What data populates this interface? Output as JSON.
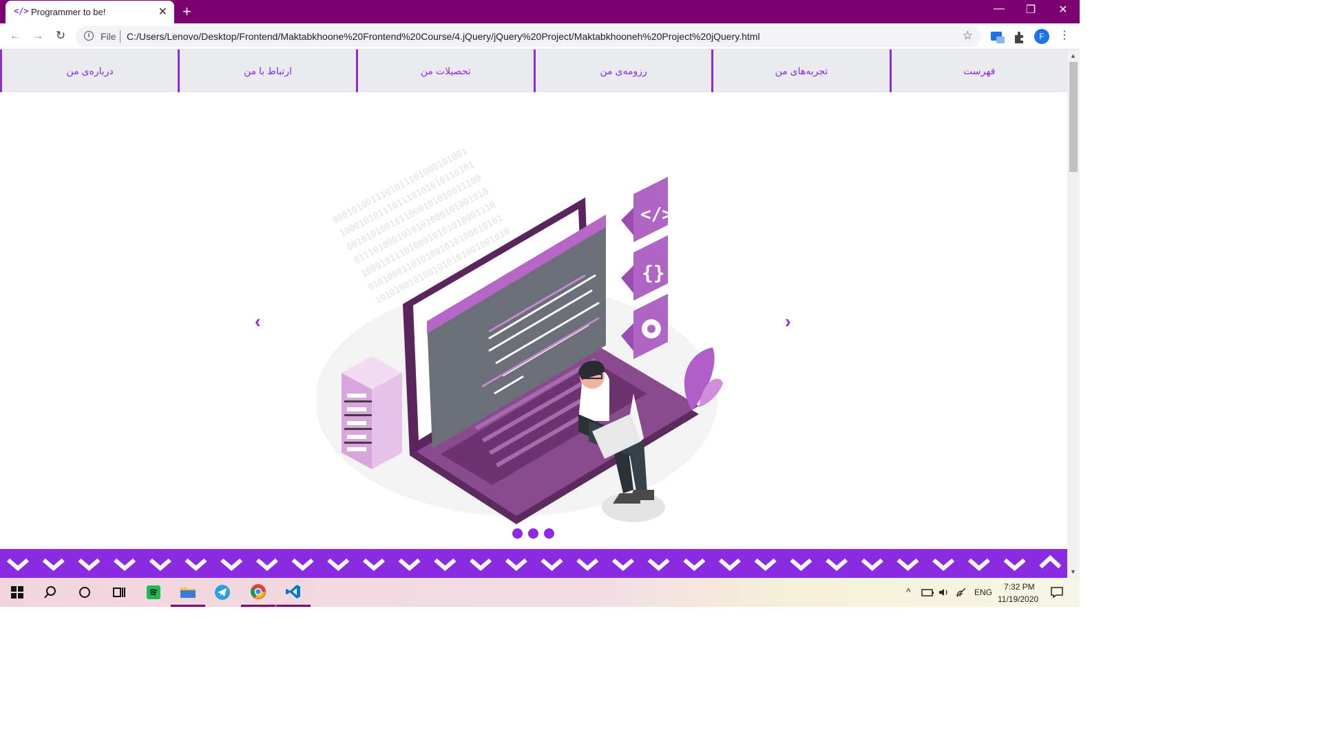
{
  "browser": {
    "tab_favicon": "</>",
    "tab_title": "Programmer to be!",
    "tab_close": "✕",
    "new_tab": "+",
    "window_controls": {
      "minimize": "—",
      "restore": "❐",
      "close": "✕"
    },
    "address": {
      "scheme_label": "File",
      "url": "C:/Users/Lenovo/Desktop/Frontend/Maktabkhoone%20Frontend%20Course/4.jQuery/jQuery%20Project/Maktabkhooneh%20Project%20jQuery.html"
    },
    "profile_initial": "F"
  },
  "nav": {
    "items": [
      {
        "label": "درباره‌ی من"
      },
      {
        "label": "ارتباط با من"
      },
      {
        "label": "تحصیلات من"
      },
      {
        "label": "رزومه‌ی من"
      },
      {
        "label": "تجربه‌های من"
      },
      {
        "label": "فهرست"
      }
    ]
  },
  "carousel": {
    "prev": "‹",
    "next": "›",
    "slide_count": 3,
    "illustration": "woman-coding-on-laptop-illustration"
  },
  "footer_band": {
    "chevron_count": 29,
    "back_to_top": "up-chevron-icon"
  },
  "taskbar": {
    "language": "ENG",
    "time": "7:32 PM",
    "date": "11/19/2020"
  },
  "colors": {
    "accent": "#8a2be2",
    "titlebar": "#7b0070",
    "nav_bg": "#e9ebef"
  }
}
